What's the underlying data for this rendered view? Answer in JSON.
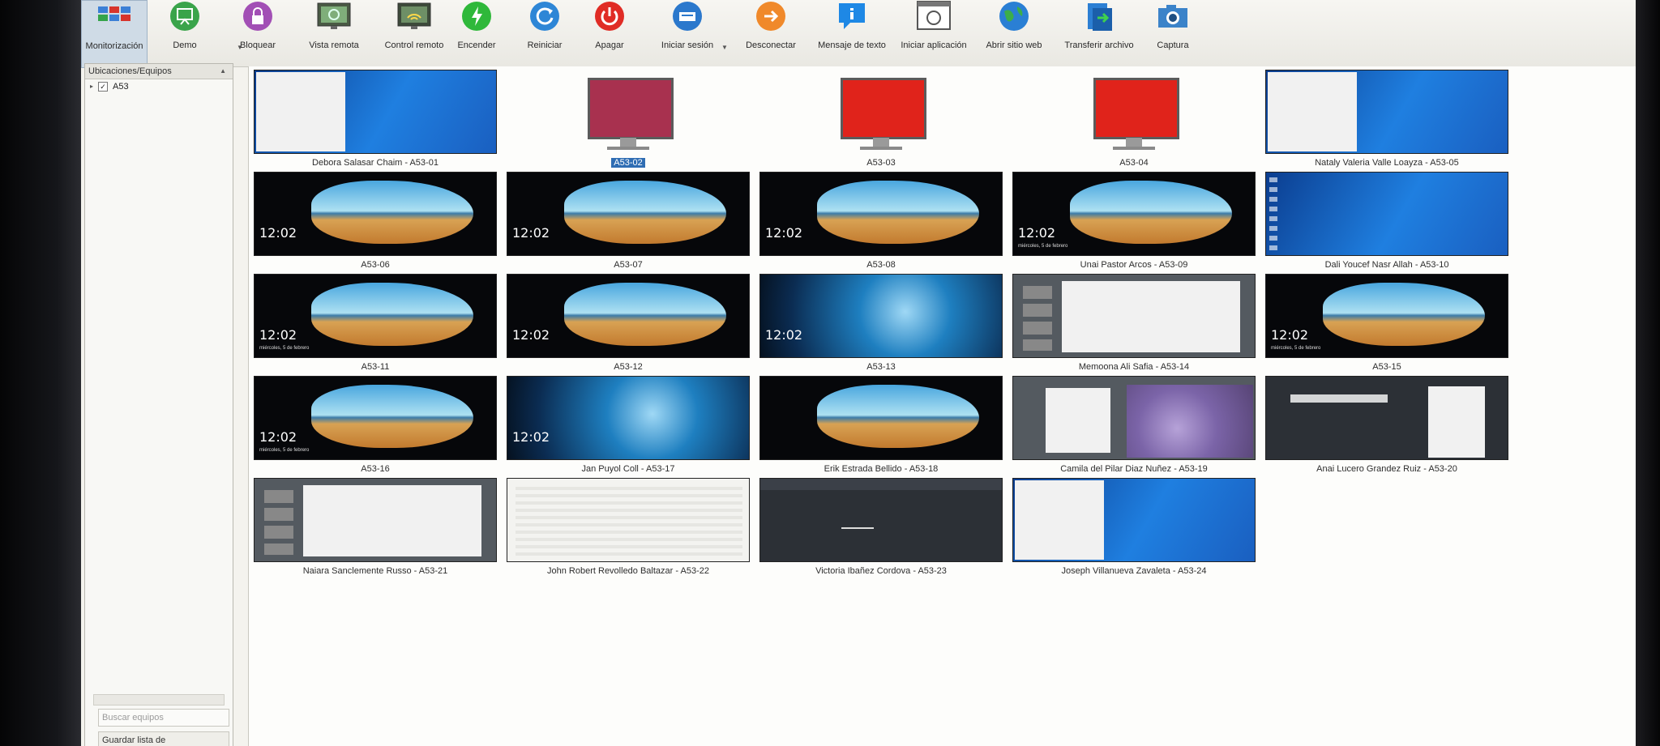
{
  "toolbar": [
    {
      "label": "Monitorización",
      "icon": "monitoring-grid-icon",
      "active": true
    },
    {
      "label": "Demo",
      "icon": "demo-presentation-icon"
    },
    {
      "label": "Bloquear",
      "icon": "lock-icon"
    },
    {
      "label": "Vista remota",
      "icon": "remote-view-icon"
    },
    {
      "label": "Control remoto",
      "icon": "remote-control-icon"
    },
    {
      "label": "Encender",
      "icon": "power-on-icon"
    },
    {
      "label": "Reiniciar",
      "icon": "restart-icon"
    },
    {
      "label": "Apagar",
      "icon": "power-off-icon"
    },
    {
      "label": "Iniciar sesión",
      "icon": "login-icon"
    },
    {
      "label": "Desconectar",
      "icon": "logout-icon"
    },
    {
      "label": "Mensaje de texto",
      "icon": "text-message-icon"
    },
    {
      "label": "Iniciar aplicación",
      "icon": "start-application-icon"
    },
    {
      "label": "Abrir sitio web",
      "icon": "globe-icon"
    },
    {
      "label": "Transferir archivo",
      "icon": "file-transfer-icon"
    },
    {
      "label": "Captura",
      "icon": "camera-icon"
    }
  ],
  "sidebar": {
    "header": "Ubicaciones/Equipos",
    "items": [
      {
        "label": "A53",
        "checked": true
      }
    ],
    "search_placeholder": "Buscar equipos",
    "save_label": "Guardar lista de equipos/usuarios"
  },
  "computers": [
    {
      "caption": "Debora Salasar Chaim - A53-01",
      "type": "desktop"
    },
    {
      "caption": "A53-02",
      "type": "offline",
      "color": "#a8314f",
      "selected": true
    },
    {
      "caption": "A53-03",
      "type": "offline",
      "color": "#e0231b"
    },
    {
      "caption": "A53-04",
      "type": "offline",
      "color": "#e0231b"
    },
    {
      "caption": "Nataly Valeria Valle Loayza - A53-05",
      "type": "desktop"
    },
    {
      "caption": "A53-06",
      "type": "lock",
      "clock": "12:02"
    },
    {
      "caption": "A53-07",
      "type": "lock",
      "clock": "12:02"
    },
    {
      "caption": "A53-08",
      "type": "lock",
      "clock": "12:02"
    },
    {
      "caption": "Unai Pastor Arcos - A53-09",
      "type": "lock",
      "clock": "12:02",
      "date": "miércoles, 5 de febrero"
    },
    {
      "caption": "Dali  Youcef Nasr Allah - A53-10",
      "type": "win10"
    },
    {
      "caption": "A53-11",
      "type": "lock",
      "clock": "12:02",
      "date": "miércoles, 5 de febrero"
    },
    {
      "caption": "A53-12",
      "type": "lock",
      "clock": "12:02"
    },
    {
      "caption": "A53-13",
      "type": "ice",
      "clock": "12:02"
    },
    {
      "caption": "Memoona Ali Safia - A53-14",
      "type": "slides"
    },
    {
      "caption": "A53-15",
      "type": "lock",
      "clock": "12:02",
      "date": "miércoles, 5 de febrero"
    },
    {
      "caption": "A53-16",
      "type": "lock",
      "clock": "12:02",
      "date": "miércoles, 5 de febrero"
    },
    {
      "caption": "Jan Puyol Coll - A53-17",
      "type": "ice",
      "clock": "12:02"
    },
    {
      "caption": "Erik Estrada Bellido - A53-18",
      "type": "lock"
    },
    {
      "caption": "Camila del Pilar Diaz Nuñez - A53-19",
      "type": "lavender"
    },
    {
      "caption": "Anai Lucero Grandez Ruiz - A53-20",
      "type": "google"
    },
    {
      "caption": "Naiara Sanclemente Russo - A53-21",
      "type": "slides"
    },
    {
      "caption": "John Robert Revolledo Baltazar - A53-22",
      "type": "doc"
    },
    {
      "caption": "Victoria Ibañez Cordova - A53-23",
      "type": "cad"
    },
    {
      "caption": "Joseph Villanueva Zavaleta - A53-24",
      "type": "desktop"
    }
  ]
}
